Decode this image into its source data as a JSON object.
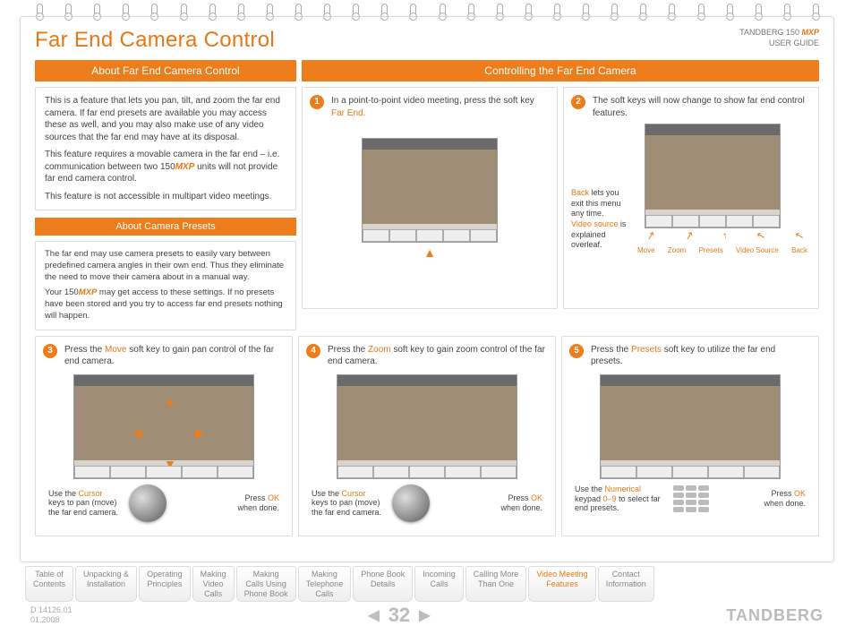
{
  "header": {
    "title": "Far End Camera Control",
    "product_line1": "TANDBERG 150",
    "product_mxp": "MXP",
    "product_line2": "USER GUIDE"
  },
  "section_left_title": "About Far End Camera Control",
  "section_right_title": "Controlling the Far End Camera",
  "about": {
    "p1": "This is a feature that lets you pan, tilt, and zoom the far end camera. If far end presets are available you may access these as well, and you may also make use of any video sources that the far end may have at its disposal.",
    "p2_a": "This feature requires a movable camera in the far end – i.e. communication between two 150",
    "p2_mxp": "MXP",
    "p2_b": " units will not provide far end camera control.",
    "p3": "This feature is not accessible in multipart video meetings."
  },
  "presets_header": "About Camera Presets",
  "presets": {
    "p1": "The far end may use camera presets to easily vary between predefined camera angles in their own end. Thus they eliminate the need to move their camera about in a manual way.",
    "p2_a": "Your 150",
    "p2_mxp": "MXP",
    "p2_b": " may get access to these settings. If no presets have been stored and you try to access far end presets nothing will happen."
  },
  "step1": {
    "num": "1",
    "text_a": "In a point-to-point video meeting, press the soft key ",
    "text_b": "Far End."
  },
  "step2": {
    "num": "2",
    "text": "The soft keys will now change to show far end control features.",
    "note_back": "Back",
    "note_back_t": " lets you exit this menu any time.",
    "note_vs": "Video source",
    "note_vs_t": " is explained overleaf.",
    "labels": [
      "Move",
      "Zoom",
      "Presets",
      "Video Source",
      "Back"
    ]
  },
  "step3": {
    "num": "3",
    "text_a": "Press the ",
    "text_hl": "Move",
    "text_b": " soft key to gain pan control of the far end camera.",
    "foot_l_a": "Use the ",
    "foot_l_hl": "Cursor",
    "foot_l_b": " keys to pan (move) the far end camera.",
    "foot_r_a": "Press ",
    "foot_r_hl": "OK",
    "foot_r_b": " when done."
  },
  "step4": {
    "num": "4",
    "text_a": "Press the ",
    "text_hl": "Zoom",
    "text_b": " soft key to gain zoom control of the far end camera.",
    "foot_l_a": "Use the ",
    "foot_l_hl": "Cursor",
    "foot_l_b": " keys to pan (move) the far end camera.",
    "foot_r_a": "Press ",
    "foot_r_hl": "OK",
    "foot_r_b": " when done."
  },
  "step5": {
    "num": "5",
    "text_a": "Press the ",
    "text_hl": "Presets",
    "text_b": " soft key to utilize the far end presets.",
    "foot_l_a": "Use the ",
    "foot_l_hl": "Numerical",
    "foot_l_b": " keypad ",
    "foot_l_hl2": "0–9",
    "foot_l_c": " to select far end presets.",
    "foot_r_a": "Press ",
    "foot_r_hl": "OK",
    "foot_r_b": " when done."
  },
  "tabs": [
    "Table of\nContents",
    "Unpacking &\nInstallation",
    "Operating\nPrinciples",
    "Making\nVideo\nCalls",
    "Making\nCalls Using\nPhone Book",
    "Making\nTelephone\nCalls",
    "Phone Book\nDetails",
    "Incoming\nCalls",
    "Calling More\nThan One",
    "Video Meeting\nFeatures",
    "Contact\nInformation"
  ],
  "active_tab": 9,
  "doc_id": "D 14126.01",
  "doc_date": "01.2008",
  "page_number": "32",
  "brand": "TANDBERG"
}
